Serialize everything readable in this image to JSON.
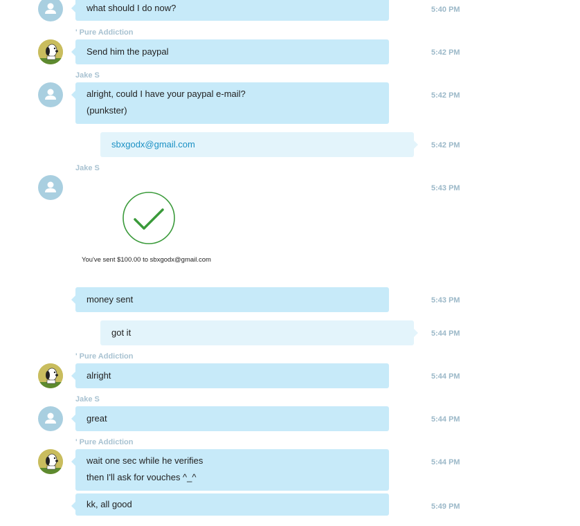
{
  "conversation": {
    "senders": {
      "pure_addiction": "' Pure Addiction",
      "jake": "Jake S"
    },
    "messages": [
      {
        "text": "what should I do now?",
        "time": "5:40 PM"
      },
      {
        "text": "Send him the paypal",
        "time": "5:42 PM"
      },
      {
        "lines": [
          "alright, could I have your paypal e-mail?",
          "(punkster)"
        ],
        "time": "5:42 PM"
      },
      {
        "text": "sbxgodx@gmail.com",
        "time": "5:42 PM"
      },
      {
        "image_caption": "You've sent $100.00 to sbxgodx@gmail.com",
        "time": "5:43 PM"
      },
      {
        "text": "money sent",
        "time": "5:43 PM"
      },
      {
        "text": "got it",
        "time": "5:44 PM"
      },
      {
        "text": "alright",
        "time": "5:44 PM"
      },
      {
        "text": "great",
        "time": "5:44 PM"
      },
      {
        "lines": [
          "wait one sec while he verifies",
          "then I'll ask for vouches ^_^"
        ],
        "time": "5:44 PM"
      },
      {
        "text": "kk, all good",
        "time": "5:49 PM"
      }
    ]
  },
  "colors": {
    "incoming_bubble": "#c7eaf9",
    "outgoing_bubble": "#e3f4fb",
    "link": "#1a90c4",
    "check_green": "#3a9a3a",
    "meta_text": "#a8c2d1"
  },
  "icons": {
    "default_avatar": "person-silhouette-icon",
    "snoopy_avatar": "snoopy-avatar-icon",
    "payment_success": "check-circle-icon"
  }
}
